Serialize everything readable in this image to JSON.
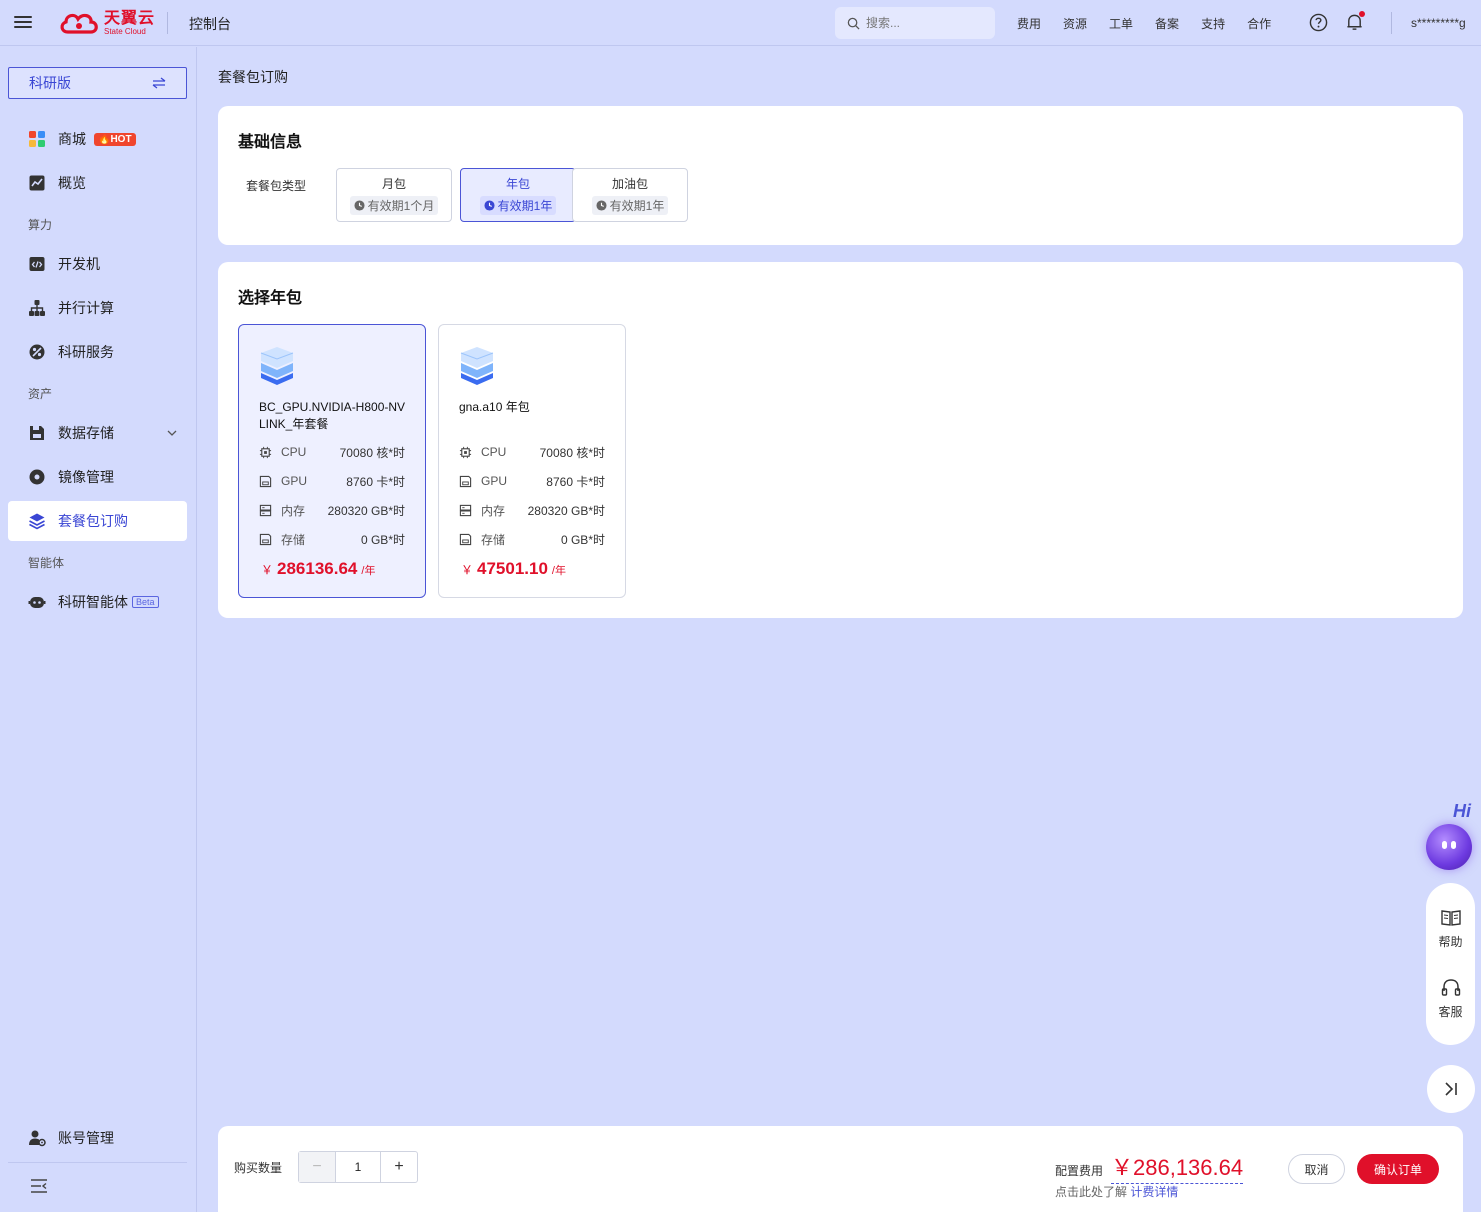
{
  "header": {
    "logo_cn": "天翼云",
    "logo_en": "State Cloud",
    "console_title": "控制台",
    "search_placeholder": "搜索...",
    "nav": [
      "费用",
      "资源",
      "工单",
      "备案",
      "支持",
      "合作"
    ],
    "user": "s*********g"
  },
  "sidebar": {
    "edition": "科研版",
    "items": {
      "mall": "商城",
      "mall_badge": "🔥HOT",
      "overview": "概览",
      "group_compute": "算力",
      "devmachine": "开发机",
      "parallel": "并行计算",
      "research_service": "科研服务",
      "group_assets": "资产",
      "storage": "数据存储",
      "image": "镜像管理",
      "package": "套餐包订购",
      "group_agent": "智能体",
      "agent": "科研智能体",
      "agent_badge": "Beta",
      "account": "账号管理"
    }
  },
  "breadcrumb": "套餐包订购",
  "basic": {
    "title": "基础信息",
    "type_label": "套餐包类型",
    "options": [
      {
        "name": "月包",
        "valid": "有效期1个月"
      },
      {
        "name": "年包",
        "valid": "有效期1年"
      },
      {
        "name": "加油包",
        "valid": "有效期1年"
      }
    ]
  },
  "select": {
    "title": "选择年包",
    "packages": [
      {
        "name": "BC_GPU.NVIDIA-H800-NVLINK_年套餐",
        "specs": [
          {
            "key": "CPU",
            "val": "70080 核*时"
          },
          {
            "key": "GPU",
            "val": "8760 卡*时"
          },
          {
            "key": "内存",
            "val": "280320 GB*时"
          },
          {
            "key": "存储",
            "val": "0 GB*时"
          }
        ],
        "currency": "￥",
        "price": "286136.64",
        "unit": "/年"
      },
      {
        "name": "gna.a10 年包",
        "specs": [
          {
            "key": "CPU",
            "val": "70080 核*时"
          },
          {
            "key": "GPU",
            "val": "8760 卡*时"
          },
          {
            "key": "内存",
            "val": "280320 GB*时"
          },
          {
            "key": "存储",
            "val": "0 GB*时"
          }
        ],
        "currency": "￥",
        "price": "47501.10",
        "unit": "/年"
      }
    ]
  },
  "bottom": {
    "qty_label": "购买数量",
    "qty_value": "1",
    "fee_label": "配置费用",
    "fee_amount": "￥286,136.64",
    "tip_text": "点击此处了解",
    "tip_link": "计费详情",
    "cancel": "取消",
    "confirm": "确认订单"
  },
  "float": {
    "hi": "Hi",
    "help": "帮助",
    "service": "客服"
  },
  "colors": {
    "accent": "#4b55d6",
    "brand_red": "#e0102a",
    "background": "#d3dafd"
  }
}
